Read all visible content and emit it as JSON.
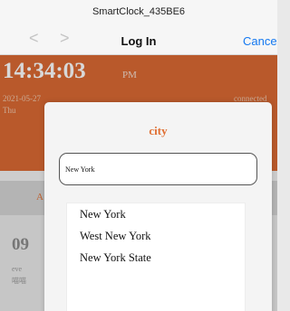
{
  "header": {
    "app_title": "SmartClock_435BE6",
    "page_title": "Log In",
    "cancel_label": "Cancel",
    "back_glyph": "<",
    "forward_glyph": ">"
  },
  "clock": {
    "time": "14:34:03",
    "ampm": "PM",
    "date": "2021-05-27",
    "weekday": "Thu",
    "status": "connected"
  },
  "background": {
    "button_letter": "A",
    "alarm_time": "09",
    "alarm_line1": "eve",
    "alarm_line2": "喵喵"
  },
  "dialog": {
    "title": "city",
    "input_value": "New York",
    "options": [
      "New York",
      "West New York",
      "New York State"
    ]
  },
  "colors": {
    "accent": "#d9652c",
    "title_orange": "#e06f33",
    "link_blue": "#1478f0"
  }
}
